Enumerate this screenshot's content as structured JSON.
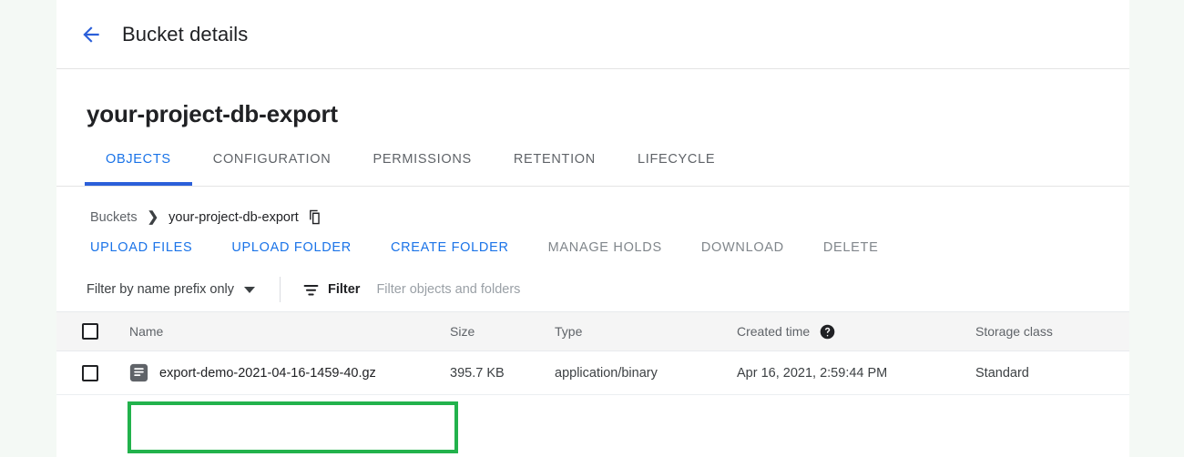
{
  "topbar": {
    "back_icon": "arrow-back-icon",
    "title": "Bucket details"
  },
  "header": {
    "bucket_name": "your-project-db-export"
  },
  "tabs": [
    {
      "label": "OBJECTS",
      "active": true
    },
    {
      "label": "CONFIGURATION",
      "active": false
    },
    {
      "label": "PERMISSIONS",
      "active": false
    },
    {
      "label": "RETENTION",
      "active": false
    },
    {
      "label": "LIFECYCLE",
      "active": false
    }
  ],
  "breadcrumb": {
    "root": "Buckets",
    "separator": "❯",
    "current": "your-project-db-export",
    "copy_icon": "copy-icon"
  },
  "actions": [
    {
      "label": "UPLOAD FILES",
      "disabled": false
    },
    {
      "label": "UPLOAD FOLDER",
      "disabled": false
    },
    {
      "label": "CREATE FOLDER",
      "disabled": false
    },
    {
      "label": "MANAGE HOLDS",
      "disabled": true
    },
    {
      "label": "DOWNLOAD",
      "disabled": true
    },
    {
      "label": "DELETE",
      "disabled": true
    }
  ],
  "filterbar": {
    "prefix_mode": "Filter by name prefix only",
    "filter_icon": "filter-list-icon",
    "filter_label": "Filter",
    "filter_placeholder": "Filter objects and folders",
    "filter_value": ""
  },
  "table": {
    "columns": [
      "Name",
      "Size",
      "Type",
      "Created time",
      "Storage class"
    ],
    "created_time_help_icon": "help-icon",
    "rows": [
      {
        "selected": false,
        "icon": "file-document-icon",
        "name": "export-demo-2021-04-16-1459-40.gz",
        "size": "395.7 KB",
        "type": "application/binary",
        "created_time": "Apr 16, 2021, 2:59:44 PM",
        "storage_class": "Standard"
      }
    ]
  },
  "colors": {
    "accent_blue": "#1a73e8",
    "tab_underline": "#2b5fd9",
    "highlight_green": "#22b24c",
    "page_background": "#f4f9f5",
    "disabled_gray": "#80868b"
  }
}
